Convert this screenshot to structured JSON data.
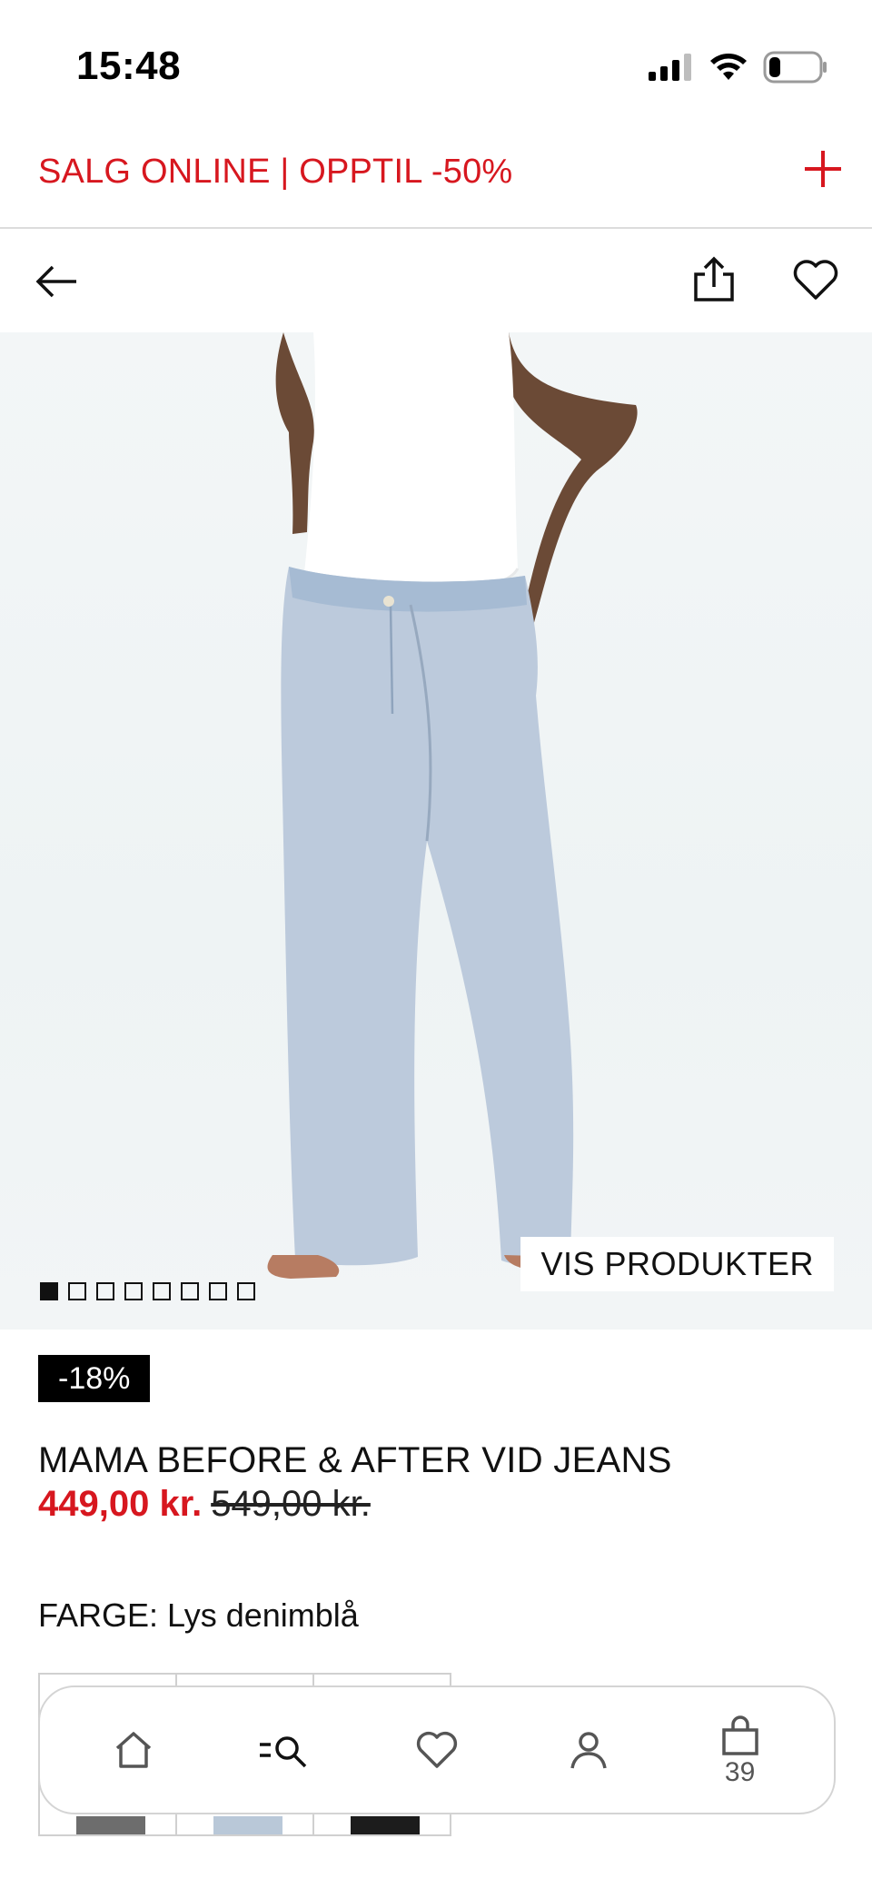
{
  "status_bar": {
    "time": "15:48"
  },
  "promo": {
    "text": "SALG ONLINE | OPPTIL -50%"
  },
  "product_image": {
    "vis_produkter": "VIS PRODUKTER",
    "image_count": 8,
    "active_index": 0
  },
  "product": {
    "discount_badge": "-18%",
    "title": "MAMA BEFORE & AFTER VID JEANS",
    "price_sale": "449,00 kr.",
    "price_original": "549,00 kr.",
    "color_label": "FARGE: Lys denimblå"
  },
  "tabbar": {
    "bag_count": "39"
  },
  "colors": {
    "accent_red": "#d7171f",
    "badge_black": "#000000"
  }
}
